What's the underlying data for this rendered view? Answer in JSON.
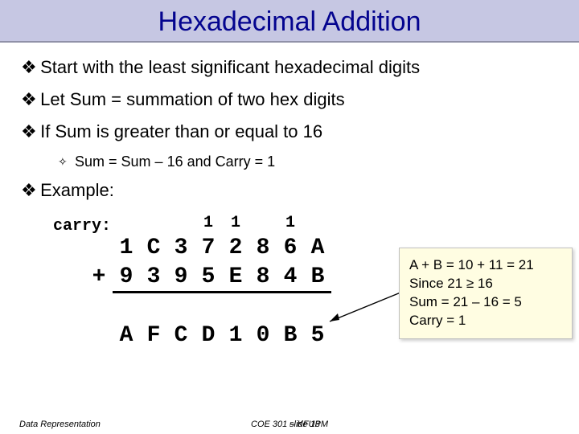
{
  "title": "Hexadecimal Addition",
  "bullets": {
    "b1": "Start with the least significant hexadecimal digits",
    "b2": "Let Sum = summation of two hex digits",
    "b3": "If Sum is greater than or equal to 16",
    "b3_sub": "Sum = Sum – 16 and Carry = 1",
    "b4": "Example:"
  },
  "diamond": "❖",
  "small_diamond": "✧",
  "carry_label": "carry:",
  "plus": "+",
  "addition": {
    "carry": [
      "",
      "",
      "",
      "1",
      "1",
      "",
      "1",
      ""
    ],
    "row1": [
      "1",
      "C",
      "3",
      "7",
      "2",
      "8",
      "6",
      "A"
    ],
    "row2": [
      "9",
      "3",
      "9",
      "5",
      "E",
      "8",
      "4",
      "B"
    ],
    "result": [
      "A",
      "F",
      "C",
      "D",
      "1",
      "0",
      "B",
      "5"
    ]
  },
  "explain": {
    "l1": "A + B = 10 + 11 = 21",
    "l2": "Since 21 ≥ 16",
    "l3": "Sum = 21 – 16 = 5",
    "l4": "Carry = 1"
  },
  "footer": {
    "left": "Data Representation",
    "center": "COE 301 – KFUPM",
    "slide": "slide 13"
  }
}
